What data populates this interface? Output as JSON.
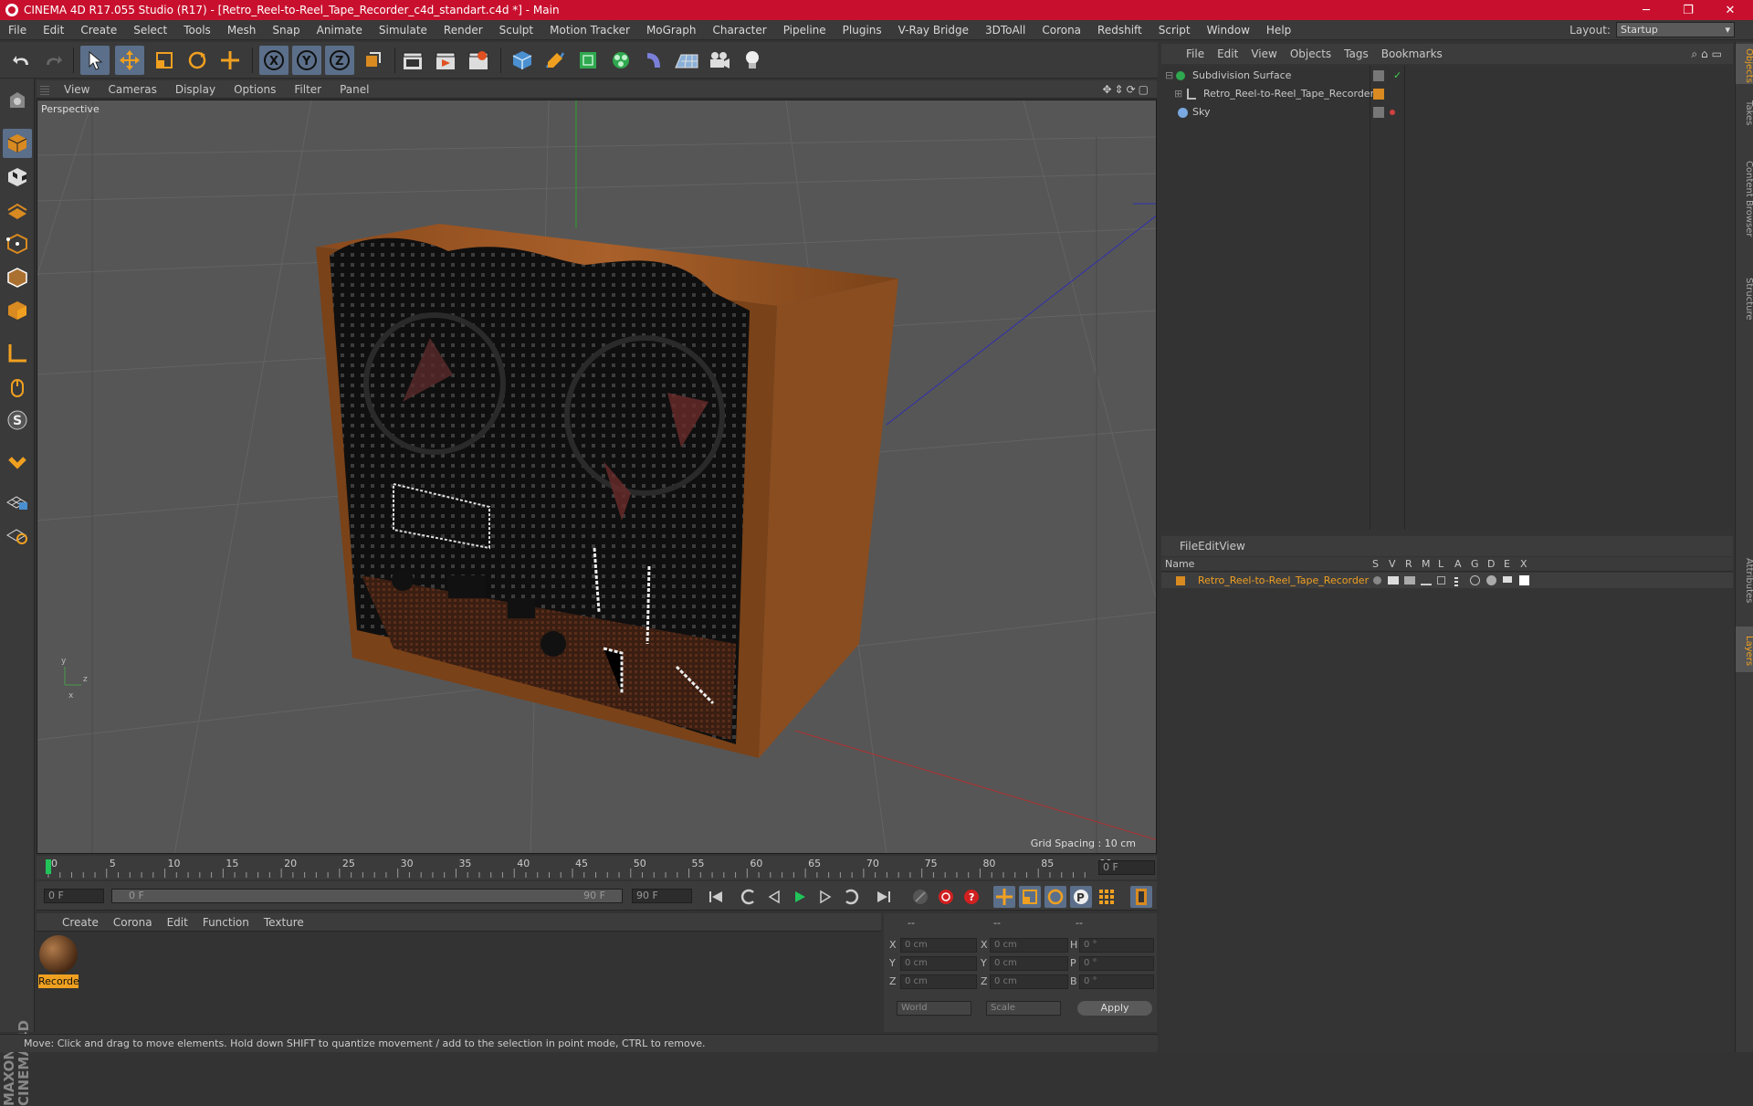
{
  "window": {
    "title": "CINEMA 4D R17.055 Studio (R17) - [Retro_Reel-to-Reel_Tape_Recorder_c4d_standart.c4d *] - Main",
    "minimize": "─",
    "restore": "❐",
    "close": "✕"
  },
  "menu": [
    "File",
    "Edit",
    "Create",
    "Select",
    "Tools",
    "Mesh",
    "Snap",
    "Animate",
    "Simulate",
    "Render",
    "Sculpt",
    "Motion Tracker",
    "MoGraph",
    "Character",
    "Pipeline",
    "Plugins",
    "V-Ray Bridge",
    "3DToAll",
    "Corona",
    "Redshift",
    "Script",
    "Window",
    "Help"
  ],
  "layout": {
    "label": "Layout:",
    "value": "Startup"
  },
  "viewport": {
    "menu": [
      "View",
      "Cameras",
      "Display",
      "Options",
      "Filter",
      "Panel"
    ],
    "label": "Perspective",
    "grid_spacing": "Grid Spacing : 10 cm"
  },
  "timeline": {
    "ticks": [
      "0",
      "5",
      "10",
      "15",
      "20",
      "25",
      "30",
      "35",
      "40",
      "45",
      "50",
      "55",
      "60",
      "65",
      "70",
      "75",
      "80",
      "85",
      "90"
    ],
    "current": "0 F"
  },
  "playback": {
    "start": "0 F",
    "range_start": "0 F",
    "range_end": "90 F",
    "end": "90 F"
  },
  "material": {
    "menu": [
      "Create",
      "Corona",
      "Edit",
      "Function",
      "Texture"
    ],
    "item_label": "Recorde"
  },
  "coords": {
    "headers": [
      "--",
      "--",
      "--"
    ],
    "rows": [
      {
        "a": "X",
        "v1": "0 cm",
        "b": "X",
        "v2": "0 cm",
        "c": "H",
        "v3": "0 °"
      },
      {
        "a": "Y",
        "v1": "0 cm",
        "b": "Y",
        "v2": "0 cm",
        "c": "P",
        "v3": "0 °"
      },
      {
        "a": "Z",
        "v1": "0 cm",
        "b": "Z",
        "v2": "0 cm",
        "c": "B",
        "v3": "0 °"
      }
    ],
    "mode1": "World",
    "mode2": "Scale",
    "apply": "Apply"
  },
  "objects": {
    "menu": [
      "File",
      "Edit",
      "View",
      "Objects",
      "Tags",
      "Bookmarks"
    ],
    "items": [
      {
        "name": "Subdivision Surface"
      },
      {
        "name": "Retro_Reel-to-Reel_Tape_Recorder"
      },
      {
        "name": "Sky"
      }
    ]
  },
  "layers": {
    "menu": [
      "File",
      "Edit",
      "View"
    ],
    "name_header": "Name",
    "cols": [
      "S",
      "V",
      "R",
      "M",
      "L",
      "A",
      "G",
      "D",
      "E",
      "X"
    ],
    "row_name": "Retro_Reel-to-Reel_Tape_Recorder"
  },
  "side_tabs": [
    "Objects",
    "Takes",
    "Content Browser",
    "Structure",
    "Attributes",
    "Layers"
  ],
  "status": "Move: Click and drag to move elements. Hold down SHIFT to quantize movement / add to the selection in point mode, CTRL to remove.",
  "brand": "MAXON CINEMA 4D",
  "colors": {
    "title_bar": "#c8102e",
    "accent_orange": "#f0a020",
    "selection_blue": "#5b6f8a"
  }
}
